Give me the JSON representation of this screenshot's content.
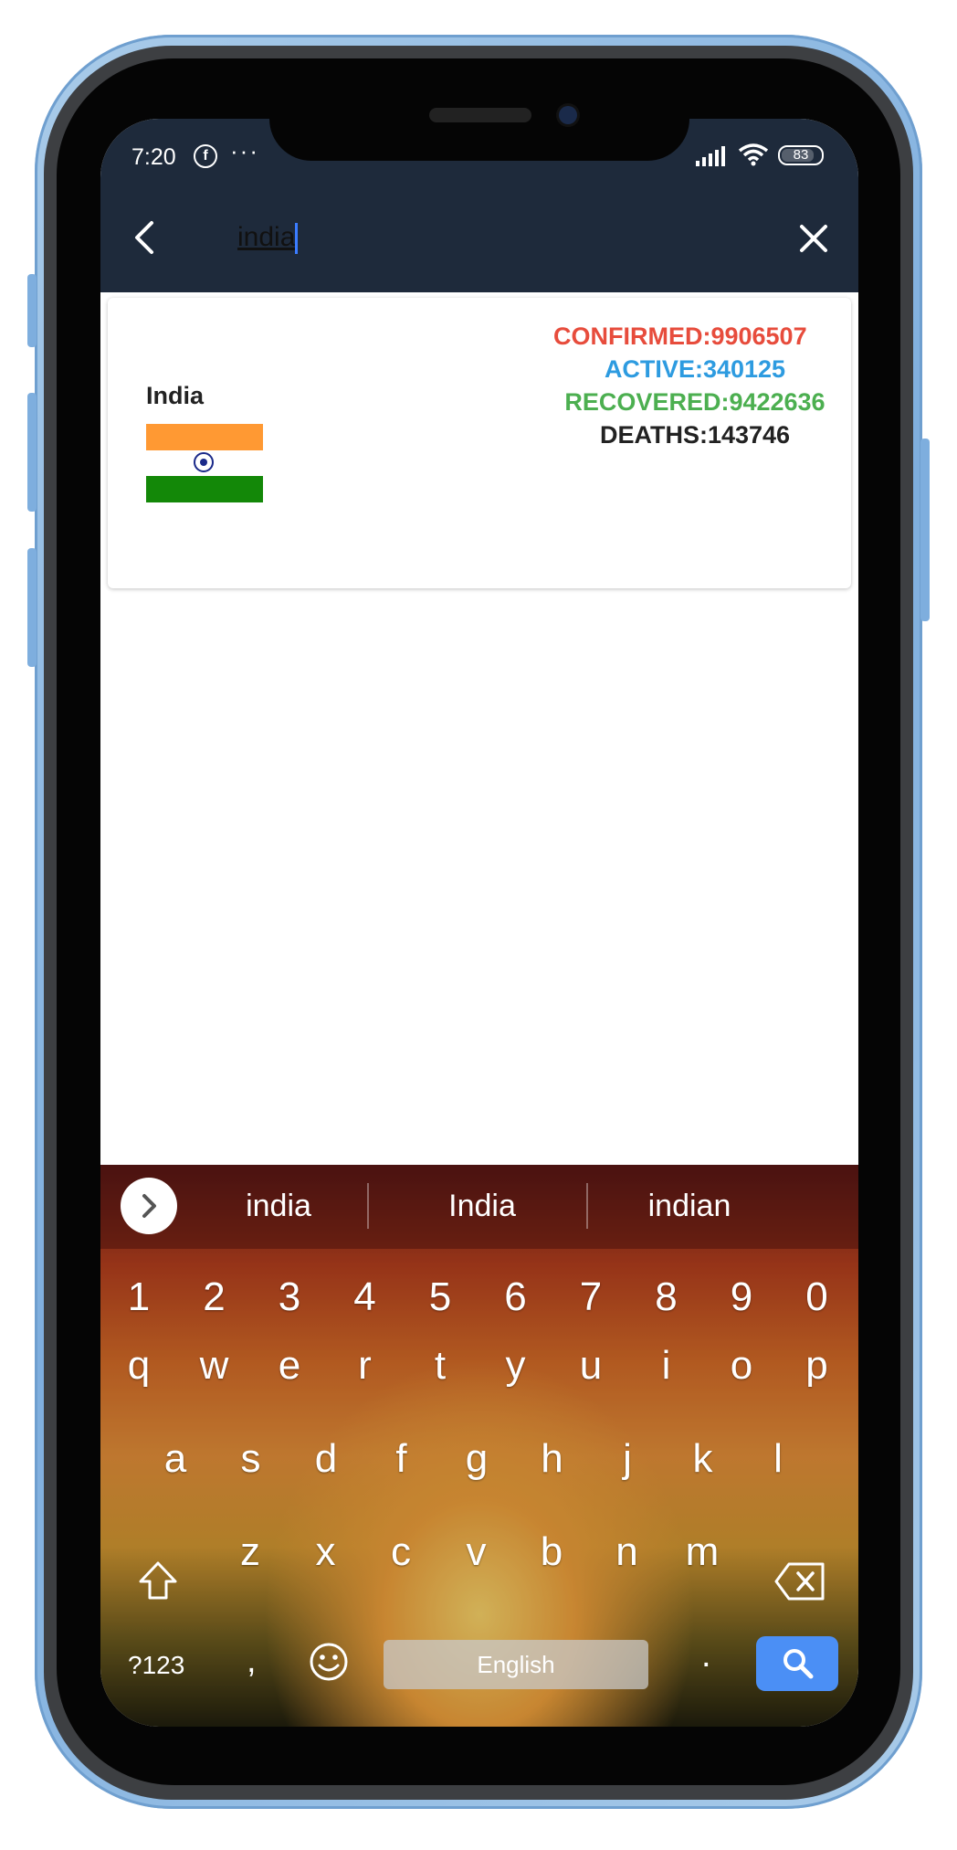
{
  "status_bar": {
    "time": "7:20",
    "more_dots": "···",
    "battery": "83",
    "battery_fraction": 0.83
  },
  "search": {
    "value": "india"
  },
  "result": {
    "country": "India",
    "confirmed": "CONFIRMED:9906507",
    "active": "ACTIVE:340125",
    "recovered": "RECOVERED:9422636",
    "deaths": "DEATHS:143746",
    "colors": {
      "confirmed": "#e74c3c",
      "active": "#2d9be0",
      "recovered": "#4caf50",
      "deaths": "#222222"
    },
    "flag_colors": [
      "#ff9933",
      "#ffffff",
      "#138808"
    ]
  },
  "keyboard": {
    "suggestions": [
      "india",
      "India",
      "indian"
    ],
    "row_numbers": [
      "1",
      "2",
      "3",
      "4",
      "5",
      "6",
      "7",
      "8",
      "9",
      "0"
    ],
    "row_top": [
      "q",
      "w",
      "e",
      "r",
      "t",
      "y",
      "u",
      "i",
      "o",
      "p"
    ],
    "row_middle": [
      "a",
      "s",
      "d",
      "f",
      "g",
      "h",
      "j",
      "k",
      "l"
    ],
    "row_bottom": [
      "z",
      "x",
      "c",
      "v",
      "b",
      "n",
      "m"
    ],
    "symbols_label": "?123",
    "comma": ",",
    "space_label": "English",
    "period": ".",
    "accent": "#4b8ff5"
  },
  "theme": {
    "header_bg": "#1e2a3b",
    "frame_blue": "#7eaede"
  }
}
